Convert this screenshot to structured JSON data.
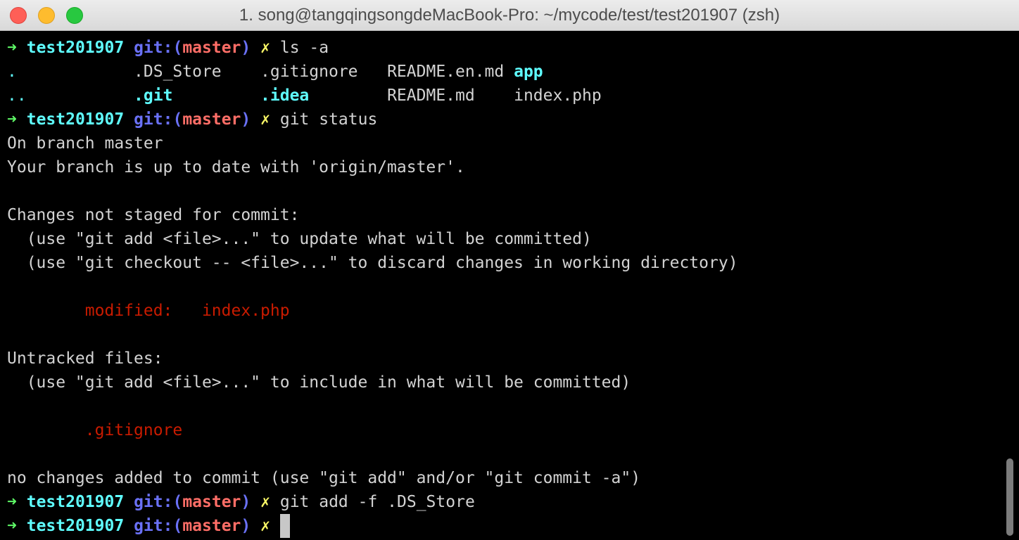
{
  "window": {
    "title": "1. song@tangqingsongdeMacBook-Pro: ~/mycode/test/test201907 (zsh)"
  },
  "prompt": {
    "arrow": "➜",
    "dir": "test201907",
    "git_open": "git:(",
    "branch": "master",
    "git_close": ")",
    "dirty": "✗"
  },
  "commands": {
    "ls": "ls -a",
    "status": "git status",
    "add": "git add -f .DS_Store"
  },
  "ls_output": {
    "row1": [
      ".",
      ".DS_Store",
      ".gitignore",
      "README.en.md",
      "app"
    ],
    "row2": [
      "..",
      ".git",
      ".idea",
      "README.md",
      "index.php"
    ]
  },
  "status_output": {
    "branch_line": "On branch master",
    "uptodate_line": "Your branch is up to date with 'origin/master'.",
    "not_staged_header": "Changes not staged for commit:",
    "hint_add": "  (use \"git add <file>...\" to update what will be committed)",
    "hint_checkout": "  (use \"git checkout -- <file>...\" to discard changes in working directory)",
    "modified_label": "modified:",
    "modified_file": "index.php",
    "untracked_header": "Untracked files:",
    "hint_include": "  (use \"git add <file>...\" to include in what will be committed)",
    "untracked_file": ".gitignore",
    "no_changes_line": "no changes added to commit (use \"git add\" and/or \"git commit -a\")"
  },
  "colors": {
    "prompt_arrow": "#5ff967",
    "directory": "#5ffdff",
    "git_label": "#6a71f6",
    "branch": "#ff6e67",
    "dirty_marker": "#fefb67",
    "modified_red": "#c91b00",
    "text": "#d3d3d3",
    "background": "#000000"
  }
}
